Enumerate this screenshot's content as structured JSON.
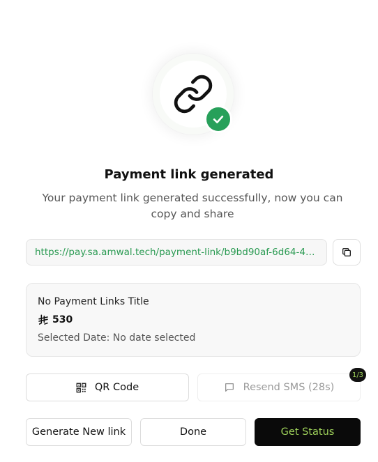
{
  "hero": {
    "icon": "link-icon",
    "badge_icon": "check-icon",
    "badge_color": "#27a05a"
  },
  "title": "Payment link generated",
  "subtitle": "Your payment link generated successfully, now you can copy and share",
  "link": {
    "url": "https://pay.sa.amwal.tech/payment-link/b9bd90af-6d64-46c...",
    "url_color": "#2a9a52",
    "copy_icon": "copy-icon"
  },
  "details": {
    "title": "No Payment Links Title",
    "currency_icon": "riyal-symbol-icon",
    "amount": "530",
    "selected_date": "Selected Date: No date selected"
  },
  "actions": {
    "qr_code_label": "QR Code",
    "resend_sms_label": "Resend SMS (28s)",
    "resend_counter": "1/3",
    "generate_new_label": "Generate New link",
    "done_label": "Done",
    "get_status_label": "Get Status"
  },
  "colors": {
    "accent": "#9ed15a",
    "dark_button": "#0a0a0a"
  }
}
